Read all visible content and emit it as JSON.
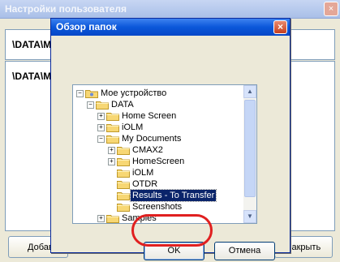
{
  "background_window": {
    "title": "Настройки пользователя",
    "close": "×",
    "row1_text": "\\DATA\\My",
    "row2_text": "\\DATA\\My",
    "add_button": "Добавить",
    "close_button": "Закрыть"
  },
  "dialog": {
    "title": "Обзор папок",
    "close": "×",
    "ok_label": "OK",
    "cancel_label": "Отмена"
  },
  "tree": [
    {
      "label": "Мое устройство",
      "expander": "−"
    },
    {
      "label": "DATA",
      "expander": "−"
    },
    {
      "label": "Home Screen",
      "expander": "+"
    },
    {
      "label": "iOLM",
      "expander": "+"
    },
    {
      "label": "My Documents",
      "expander": "−"
    },
    {
      "label": "CMAX2",
      "expander": "+"
    },
    {
      "label": "HomeScreen",
      "expander": "+"
    },
    {
      "label": "iOLM",
      "expander": ""
    },
    {
      "label": "OTDR",
      "expander": ""
    },
    {
      "label": "Results - To Transfer",
      "expander": "",
      "selected": true
    },
    {
      "label": "Screenshots",
      "expander": ""
    },
    {
      "label": "Samples",
      "expander": "+"
    }
  ],
  "scroll": {
    "up": "▲",
    "down": "▼"
  },
  "colors": {
    "selection": "#0a246a",
    "highlight_ring": "#e02020",
    "title_bar": "#0b57d9"
  }
}
